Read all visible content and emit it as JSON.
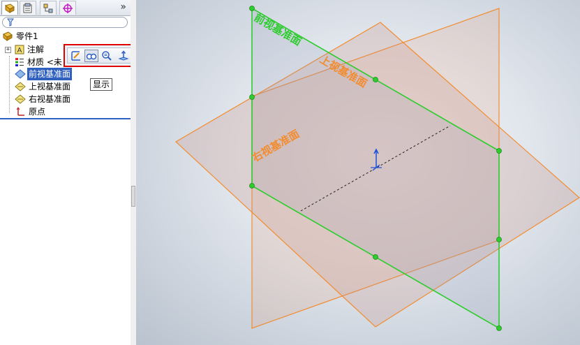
{
  "feature_manager": {
    "tabs": [
      {
        "name": "feature-manager-tab",
        "active": true
      },
      {
        "name": "property-manager-tab",
        "active": false
      },
      {
        "name": "configuration-manager-tab",
        "active": false
      },
      {
        "name": "dimxpert-manager-tab",
        "active": false
      }
    ],
    "expand_symbol": "»",
    "tree": {
      "root": "零件1",
      "items": [
        {
          "label": "注解",
          "icon": "annotation-icon",
          "expandable": true
        },
        {
          "label": "材质 <未",
          "icon": "material-icon",
          "expandable": false
        },
        {
          "label": "前视基准面",
          "icon": "plane-icon",
          "selected": true
        },
        {
          "label": "上视基准面",
          "icon": "plane-icon",
          "selected": false
        },
        {
          "label": "右视基准面",
          "icon": "plane-icon",
          "selected": false
        },
        {
          "label": "原点",
          "icon": "origin-icon",
          "selected": false
        }
      ]
    }
  },
  "context_toolbar": {
    "buttons": [
      {
        "name": "edit-sketch-icon"
      },
      {
        "name": "show-hide-icon",
        "pressed": true
      },
      {
        "name": "zoom-to-selection-icon"
      },
      {
        "name": "normal-to-icon"
      }
    ],
    "tooltip": "显示"
  },
  "viewport": {
    "planes": {
      "front": "前视基准面",
      "top": "上视基准面",
      "right": "右视基准面"
    }
  },
  "colors": {
    "front_plane": "#2ecc2e",
    "top_right_plane": "#f28c30",
    "selection": "#2f5fbf",
    "highlight_box": "#e00000"
  }
}
